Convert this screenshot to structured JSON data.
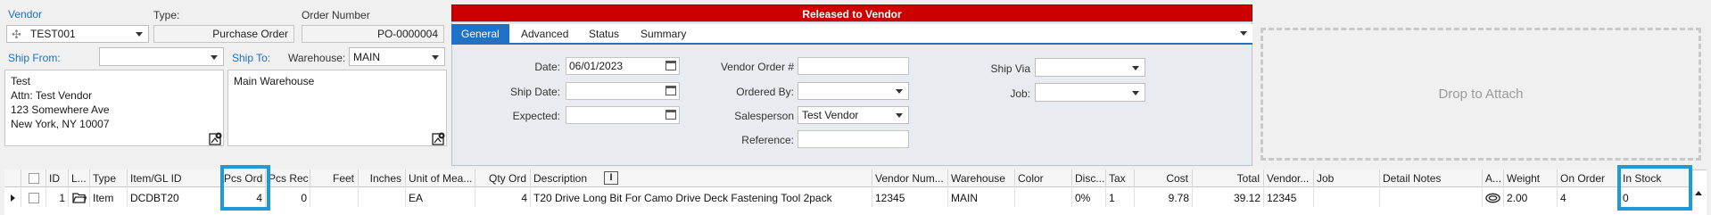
{
  "vendor": {
    "label": "Vendor",
    "value": "TEST001"
  },
  "type": {
    "label": "Type:",
    "value": "Purchase Order"
  },
  "order_number": {
    "label": "Order Number",
    "value": "PO-0000004"
  },
  "ship_from": {
    "label": "Ship From:",
    "value": "",
    "address": [
      "Test",
      "Attn: Test Vendor",
      "123 Somewhere Ave",
      "New York, NY 10007"
    ]
  },
  "ship_to": {
    "label": "Ship To:",
    "warehouse_label": "Warehouse:",
    "warehouse_value": "MAIN",
    "address": [
      "Main Warehouse"
    ]
  },
  "status_banner": "Released to Vendor",
  "tabs": [
    {
      "label": "General",
      "active": true
    },
    {
      "label": "Advanced",
      "active": false
    },
    {
      "label": "Status",
      "active": false
    },
    {
      "label": "Summary",
      "active": false
    }
  ],
  "general": {
    "date_label": "Date:",
    "date_value": "06/01/2023",
    "ship_date_label": "Ship Date:",
    "ship_date_value": "",
    "expected_label": "Expected:",
    "expected_value": "",
    "vendor_order_label": "Vendor Order #",
    "vendor_order_value": "",
    "ordered_by_label": "Ordered By:",
    "ordered_by_value": "",
    "salesperson_label": "Salesperson",
    "salesperson_value": "Test Vendor",
    "reference_label": "Reference:",
    "reference_value": "",
    "ship_via_label": "Ship Via",
    "ship_via_value": "",
    "job_label": "Job:",
    "job_value": ""
  },
  "drop_zone": "Drop to Attach",
  "grid": {
    "headers": {
      "id": "ID",
      "l": "L...",
      "type": "Type",
      "item": "Item/GL ID",
      "pcs_ord": "Pcs Ord",
      "pcs_rec": "Pcs Rec",
      "feet": "Feet",
      "inches": "Inches",
      "uom": "Unit of Mea...",
      "qty_ord": "Qty Ord",
      "description": "Description",
      "vendor_num": "Vendor Num...",
      "warehouse": "Warehouse",
      "color": "Color",
      "disc": "Disc...",
      "tax": "Tax",
      "cost": "Cost",
      "total": "Total",
      "vendor": "Vendor...",
      "job": "Job",
      "detail_notes": "Detail Notes",
      "a": "A...",
      "weight": "Weight",
      "on_order": "On Order",
      "in_stock": "In Stock"
    },
    "row": {
      "id": "1",
      "type": "Item",
      "item": "DCDBT20",
      "pcs_ord": "4",
      "pcs_rec": "0",
      "feet": "",
      "inches": "",
      "uom": "EA",
      "qty_ord": "4",
      "description": "T20 Drive Long Bit For Camo Drive Deck Fastening Tool 2pack",
      "vendor_num": "12345",
      "warehouse": "MAIN",
      "color": "",
      "disc": "0%",
      "tax": "1",
      "cost": "9.78",
      "total": "39.12",
      "vendor": "12345",
      "job": "",
      "detail_notes": "",
      "weight": "2.00",
      "on_order": "4",
      "in_stock": "0"
    }
  },
  "colors": {
    "accent": "#1e73c8",
    "banner": "#cc0000",
    "highlight": "#1e9ad6"
  }
}
